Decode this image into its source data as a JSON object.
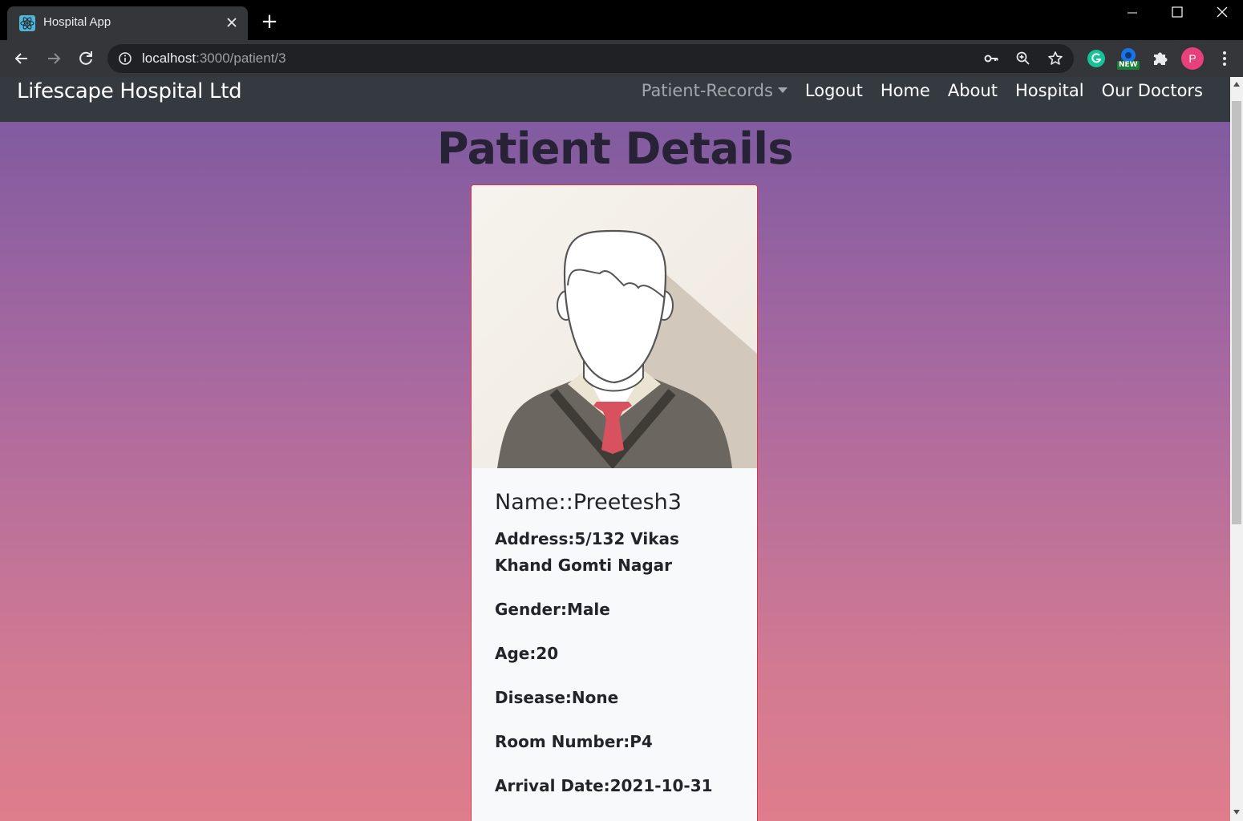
{
  "browser": {
    "tab_title": "Hospital App",
    "new_tab_symbol": "+",
    "url_host": "localhost",
    "url_path": ":3000/patient/3",
    "profile_initial": "P",
    "ext_badge": "NEW",
    "icons": [
      "react-favicon-icon",
      "close-icon",
      "back-arrow-icon",
      "forward-arrow-icon",
      "reload-icon",
      "info-icon",
      "key-icon",
      "zoom-icon",
      "star-icon",
      "grammarly-icon",
      "extension-new-icon",
      "puzzle-icon",
      "profile-avatar",
      "kebab-menu-icon"
    ]
  },
  "navbar": {
    "brand": "Lifescape Hospital Ltd",
    "links": {
      "patient_records": "Patient-Records",
      "logout": "Logout",
      "home": "Home",
      "about": "About",
      "hospital": "Hospital",
      "our_doctors": "Our Doctors"
    }
  },
  "main": {
    "title": "Patient Details",
    "patient": {
      "name": "Name::Preetesh3",
      "address": "Address:5/132 Vikas Khand Gomti Nagar",
      "gender": "Gender:Male",
      "age": "Age:20",
      "disease": "Disease:None",
      "room": "Room Number:P4",
      "arrival": "Arrival Date:2021-10-31"
    }
  },
  "colors": {
    "navbar_bg": "#343a40",
    "card_border": "#dc3545",
    "gradient_top": "#7a58a0",
    "gradient_bottom": "#de7d8c"
  }
}
